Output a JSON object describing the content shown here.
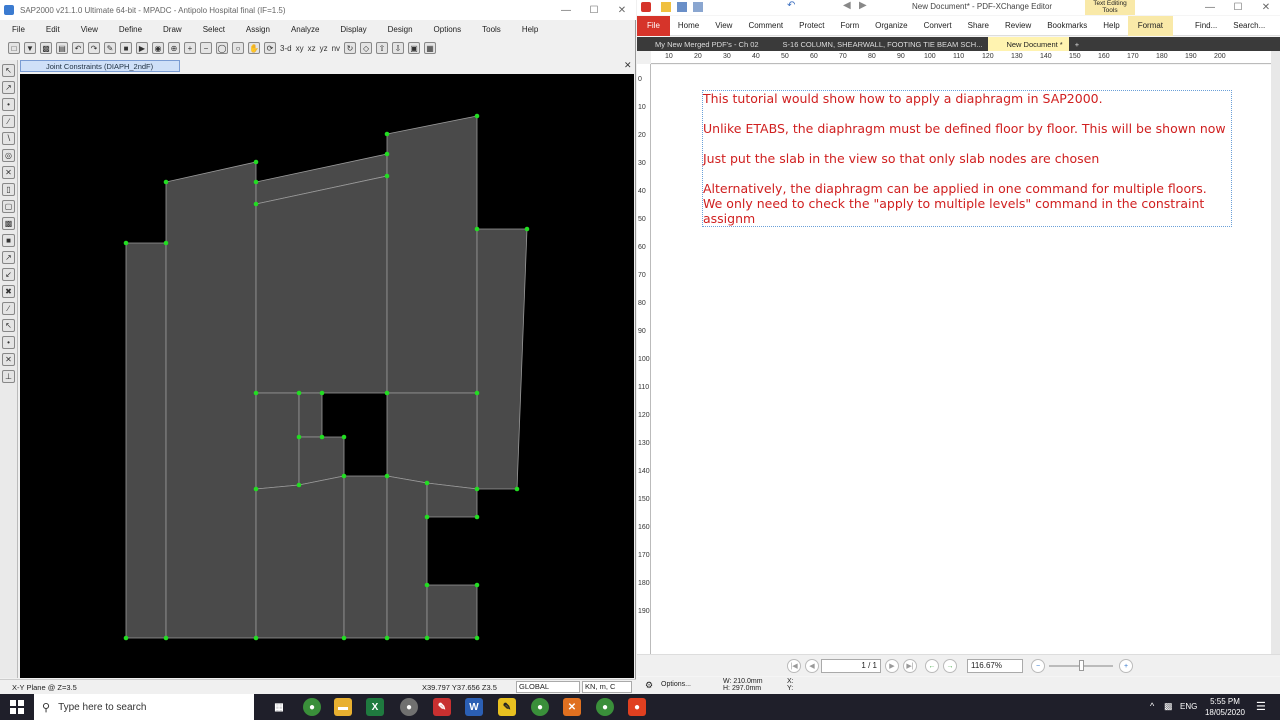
{
  "sap": {
    "title": "SAP2000 v21.1.0 Ultimate 64-bit - MPADC - Antipolo Hospital final (IF=1.5)",
    "menu": [
      "File",
      "Edit",
      "View",
      "Define",
      "Draw",
      "Select",
      "Assign",
      "Analyze",
      "Display",
      "Design",
      "Options",
      "Tools",
      "Help"
    ],
    "toolbar_text": [
      "3-d",
      "xy",
      "xz",
      "yz",
      "nv"
    ],
    "window_tab": "Joint Constraints (DIAPH_2ndF)",
    "status_plane": "X-Y Plane @ Z=3.5",
    "status_coords": "X39.797  Y37.656  Z3.5",
    "status_coord_system": "GLOBAL",
    "status_units": "KN, m, C",
    "colors": {
      "canvas": "#000000",
      "slab": "#4a4a4a",
      "joint": "#22dd22",
      "edge": "#9a9a9a"
    }
  },
  "pdf": {
    "title": "New Document* - PDF-XChange Editor",
    "context_tab": "Text Editing Tools",
    "ribbon": [
      "File",
      "Home",
      "View",
      "Comment",
      "Protect",
      "Form",
      "Organize",
      "Convert",
      "Share",
      "Review",
      "Bookmarks",
      "Help",
      "Format"
    ],
    "find_label": "Find...",
    "search_label": "Search...",
    "doc_tabs": [
      {
        "label": "My New Merged PDF's - Ch 02"
      },
      {
        "label": "S-16 COLUMN, SHEARWALL, FOOTING TIE BEAM SCH..."
      },
      {
        "label": "New Document *"
      }
    ],
    "ruler_top": [
      "10",
      "20",
      "30",
      "40",
      "50",
      "60",
      "70",
      "80",
      "90",
      "100",
      "110",
      "120",
      "130",
      "140",
      "150",
      "160",
      "170",
      "180",
      "190",
      "200"
    ],
    "ruler_left": [
      "0",
      "10",
      "20",
      "30",
      "40",
      "50",
      "60",
      "70",
      "80",
      "90",
      "100",
      "110",
      "120",
      "130",
      "140",
      "150",
      "160",
      "170",
      "180",
      "190"
    ],
    "text_lines": [
      "This tutorial would show how to apply a diaphragm in SAP2000.",
      "",
      "Unlike ETABS, the diaphragm must be defined floor by floor. This will be shown now",
      "",
      "Just put the slab in the view so that only slab nodes are chosen",
      "",
      "Alternatively, the diaphragm can be applied in one command for multiple floors.",
      "We only need to check the \"apply to multiple levels\" command in the constraint",
      "assignm"
    ],
    "page_indicator": "1 / 1",
    "zoom": "116.67%",
    "options_label": "Options...",
    "page_width": "W: 210.0mm",
    "page_height": "H: 297.0mm",
    "cursor_x": "X:",
    "cursor_y": "Y:",
    "text_color": "#d02020"
  },
  "taskbar": {
    "search_placeholder": "Type here to search",
    "language": "ENG",
    "time": "5:55 PM",
    "date": "18/05/2020"
  }
}
